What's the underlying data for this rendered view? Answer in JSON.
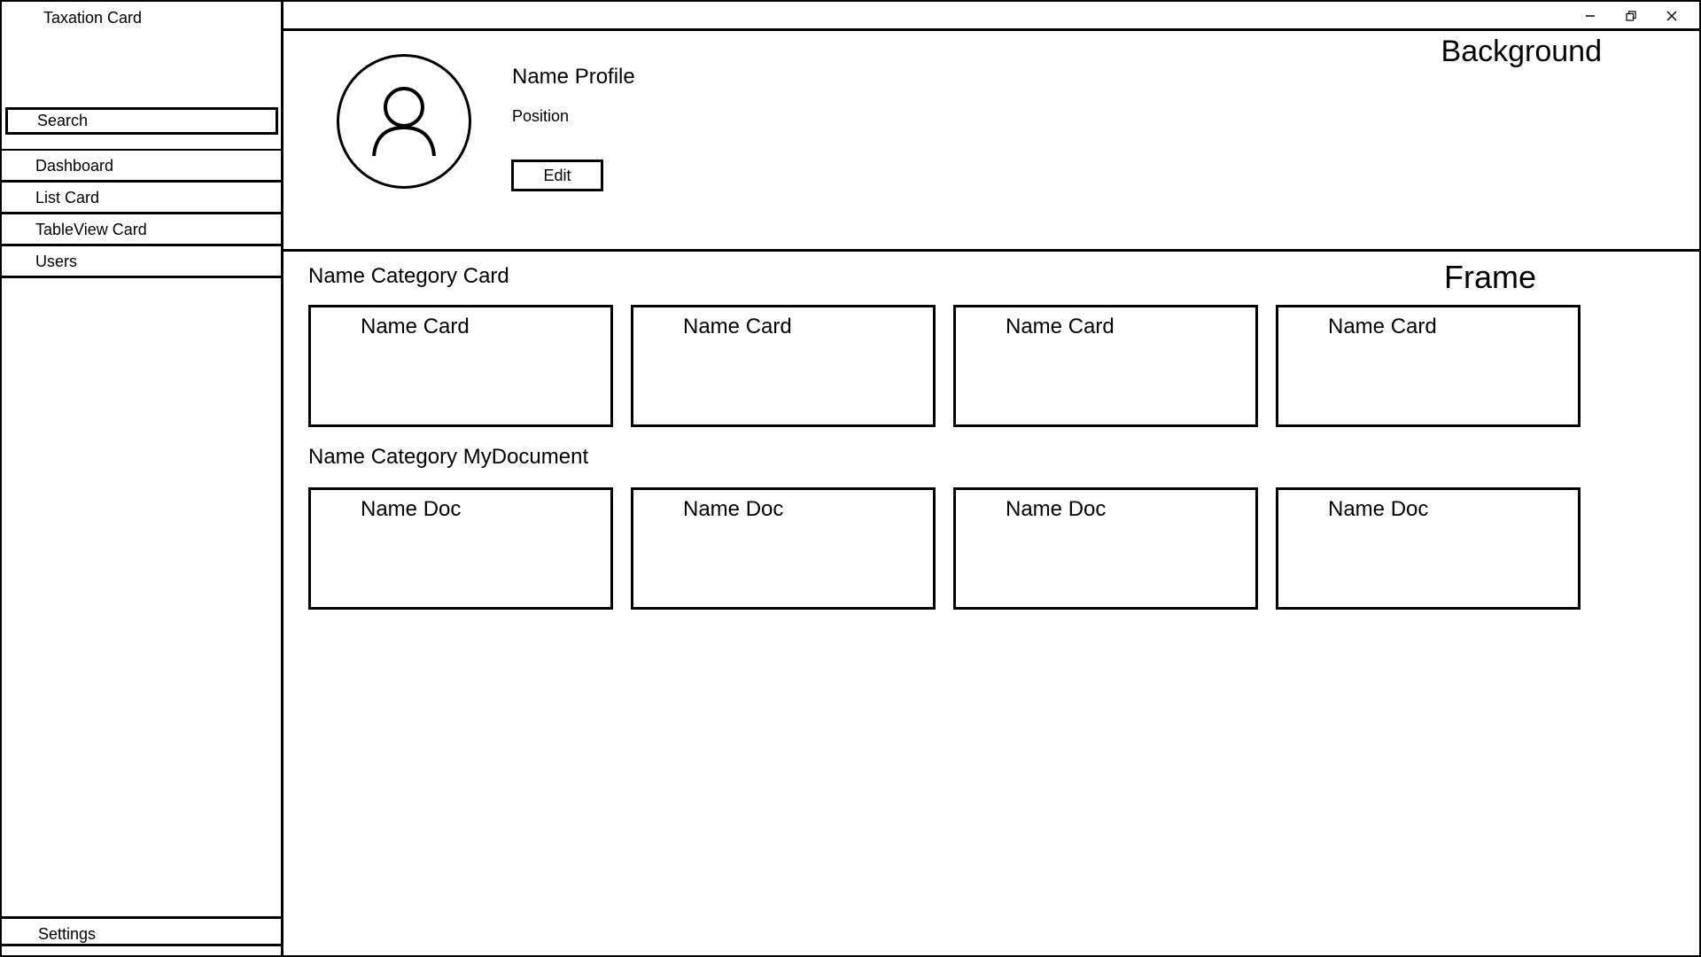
{
  "app": {
    "title": "Taxation Card"
  },
  "sidebar": {
    "search_label": "Search",
    "items": [
      {
        "label": "Dashboard"
      },
      {
        "label": "List Card"
      },
      {
        "label": "TableView Card"
      },
      {
        "label": "Users"
      }
    ],
    "settings_label": "Settings"
  },
  "window_controls": {
    "icons": [
      "minimize-icon",
      "restore-icon",
      "close-icon"
    ]
  },
  "profile": {
    "name": "Name Profile",
    "position": "Position",
    "edit_label": "Edit",
    "avatar_icon": "user-icon",
    "background_label": "Background"
  },
  "main": {
    "frame_label": "Frame",
    "card_section_title": "Name Category Card",
    "cards": [
      {
        "label": "Name Card"
      },
      {
        "label": "Name Card"
      },
      {
        "label": "Name Card"
      },
      {
        "label": "Name Card"
      }
    ],
    "doc_section_title": "Name Category MyDocument",
    "docs": [
      {
        "label": "Name Doc"
      },
      {
        "label": "Name Doc"
      },
      {
        "label": "Name Doc"
      },
      {
        "label": "Name Doc"
      }
    ]
  },
  "colors": {
    "border": "#000000",
    "background": "#ffffff"
  }
}
